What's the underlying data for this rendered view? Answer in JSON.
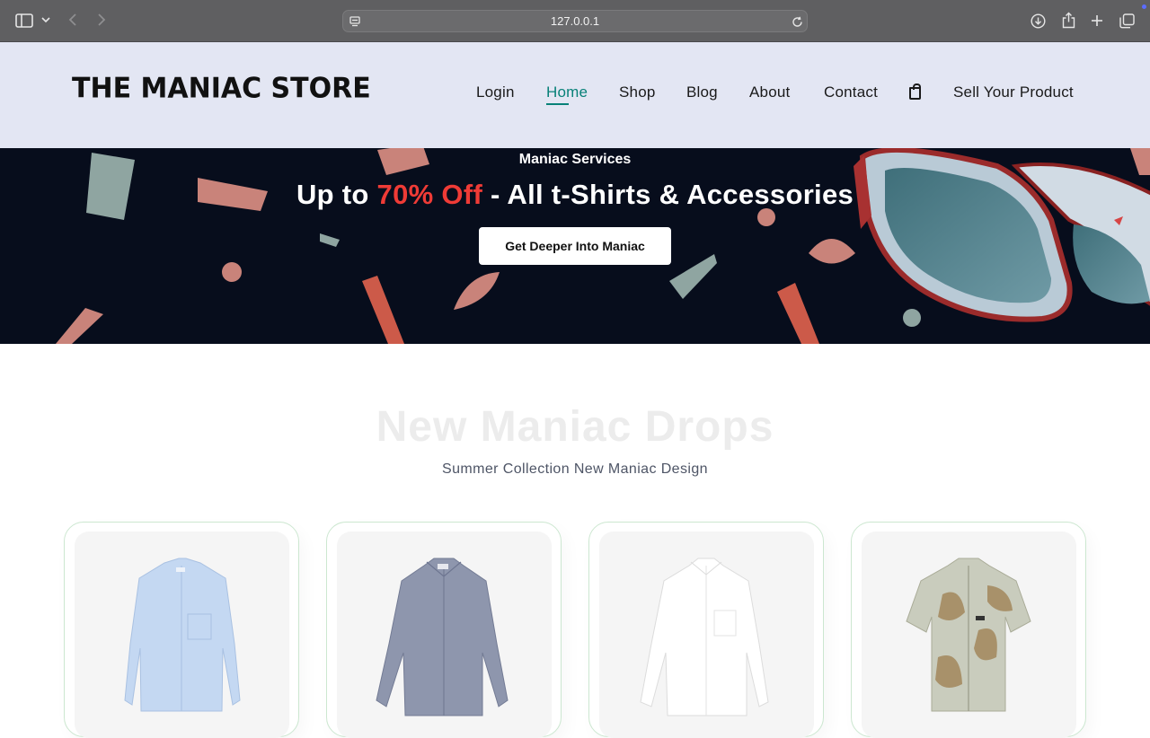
{
  "browser": {
    "url": "127.0.0.1",
    "icons": [
      "sidebar-icon",
      "chevron-down-icon",
      "back-icon",
      "forward-icon",
      "site-settings-icon",
      "reload-icon",
      "download-icon",
      "share-icon",
      "new-tab-icon",
      "tabs-overview-icon"
    ]
  },
  "header": {
    "logo": "THE MANIAC STORE",
    "nav": [
      {
        "label": "Login"
      },
      {
        "label": "Home",
        "active": true
      },
      {
        "label": "Shop"
      },
      {
        "label": "Blog"
      },
      {
        "label": "About"
      },
      {
        "label": "Contact"
      },
      {
        "label": "Sell Your Product"
      }
    ],
    "cart_icon": "shopping-bag-icon"
  },
  "hero": {
    "subtitle": "Maniac Services",
    "title_prefix": "Up to ",
    "title_highlight": "70% Off",
    "title_suffix": " - All t-Shirts & Accessories",
    "button_label": "Get Deeper Into Maniac"
  },
  "section": {
    "title": "New Maniac Drops",
    "subtitle": "Summer Collection New Maniac Design"
  },
  "products": [
    {
      "image": "light-blue-shirt"
    },
    {
      "image": "grey-blue-linen-shirt"
    },
    {
      "image": "white-shirt"
    },
    {
      "image": "patterned-short-sleeve-shirt"
    }
  ],
  "colors": {
    "accent": "#088178",
    "header_bg": "#e3e6f3",
    "hero_bg": "#070d1c",
    "highlight": "#ef3b36",
    "card_border": "#cce7d0"
  }
}
